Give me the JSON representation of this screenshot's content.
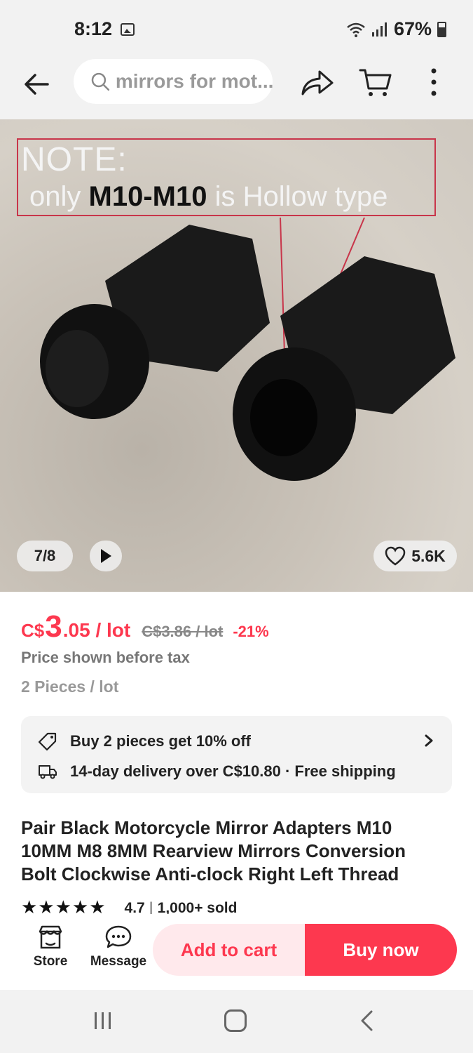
{
  "status_bar": {
    "time": "8:12",
    "battery": "67%"
  },
  "search": {
    "query": "mirrors for mot..."
  },
  "image": {
    "note_title": "NOTE:",
    "note_pre": "only",
    "note_highlight": "M10-M10",
    "note_post": "is Hollow type",
    "counter": "7/8",
    "likes": "5.6K"
  },
  "price": {
    "currency": "C$",
    "integer": "3",
    "fraction": ".05 / lot",
    "original": "C$3.86 / lot",
    "discount": "-21%",
    "tax_note": "Price shown before tax",
    "unit": "2 Pieces / lot"
  },
  "promo": {
    "offer": "Buy 2 pieces get 10% off",
    "delivery": "14-day delivery over C$10.80 · Free shipping"
  },
  "product": {
    "title": "Pair Black Motorcycle Mirror Adapters M10 10MM M8 8MM Rearview Mirrors Conversion Bolt Clockwise Anti-clock Right Left Thread",
    "stars": "★★★★★",
    "rating": "4.7",
    "sold": "1,000+ sold"
  },
  "actions": {
    "store": "Store",
    "message": "Message",
    "add_to_cart": "Add to cart",
    "buy_now": "Buy now"
  },
  "colors": {
    "accent": "#fd384f",
    "accent_light": "#ffe9ec",
    "bar_bg": "#f2f2f2"
  }
}
